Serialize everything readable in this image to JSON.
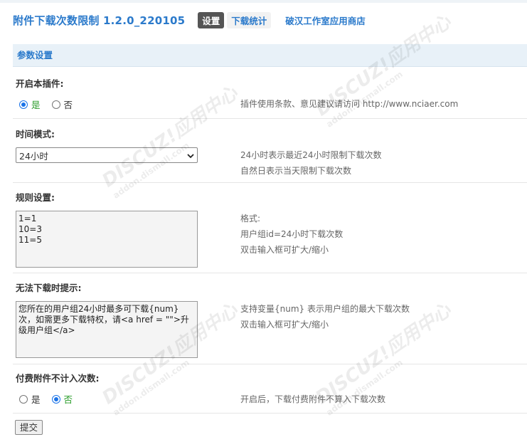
{
  "header": {
    "title": "附件下载次数限制 1.2.0_220105",
    "tabs": [
      {
        "label": "设置"
      },
      {
        "label": "下载统计"
      },
      {
        "label": "破汉工作室应用商店"
      }
    ]
  },
  "section_title": "参数设置",
  "settings": {
    "enable": {
      "label": "开启本插件:",
      "options": [
        "是",
        "否"
      ],
      "selected": "是",
      "tip": "插件使用条款、意见建议请访问 http://www.nciaer.com"
    },
    "time_mode": {
      "label": "时间模式:",
      "value": "24小时",
      "tips": [
        "24小时表示最近24小时限制下载次数",
        "自然日表示当天限制下载次数"
      ]
    },
    "rules": {
      "label": "规则设置:",
      "value": "1=1\n10=3\n11=5",
      "tips": [
        "格式:",
        "用户组id=24小时下载次数",
        "双击输入框可扩大/缩小"
      ]
    },
    "limit_message": {
      "label": "无法下载时提示:",
      "value": "您所在的用户组24小时最多可下载{num}次，如需更多下载特权，请<a href = \"\">升级用户组</a>",
      "tips": [
        "支持变量{num} 表示用户组的最大下载次数",
        "双击输入框可扩大/缩小"
      ]
    },
    "paid_exclude": {
      "label": "付费附件不计入次数:",
      "options": [
        "是",
        "否"
      ],
      "selected": "否",
      "tip": "开启后，下载付费附件不算入下载次数"
    }
  },
  "submit_label": "提交",
  "watermark": {
    "big": "DISCUZ!应用中心",
    "small": "addon.dismall.com"
  }
}
